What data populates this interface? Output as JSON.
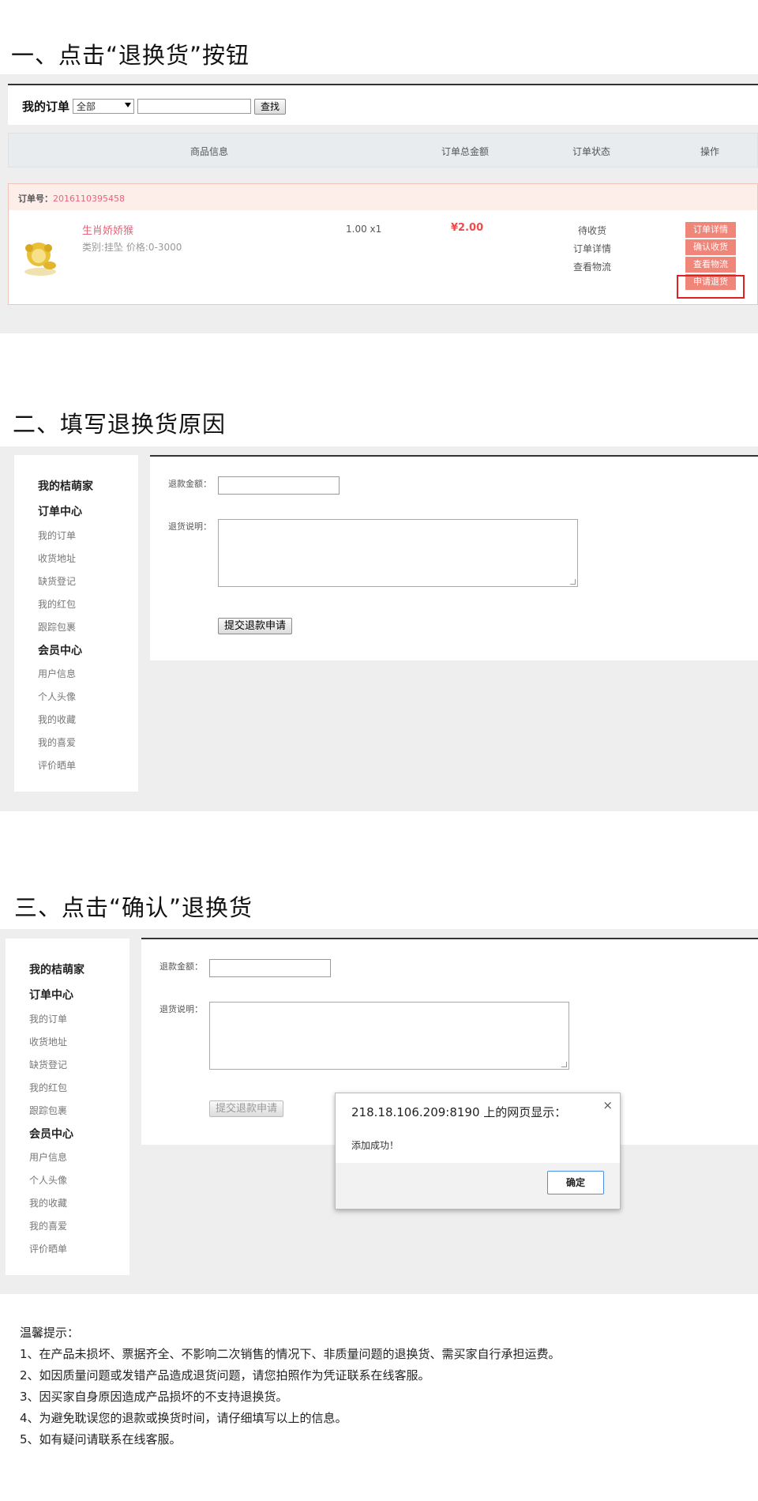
{
  "section1": {
    "title": "一、点击“退换货”按钮",
    "search": {
      "label": "我的订单",
      "select_value": "全部",
      "button": "查找"
    },
    "table_headers": [
      "商品信息",
      "订单总金额",
      "订单状态",
      "操作"
    ],
    "order": {
      "number_label": "订单号：",
      "number": "2016110395458",
      "product_name": "生肖娇娇猴",
      "product_meta": "类别:挂坠 价格:0-3000",
      "qty": "1.00 x1",
      "price": "¥2.00",
      "status_links": [
        "待收货",
        "订单详情",
        "查看物流"
      ],
      "actions": [
        "订单详情",
        "确认收货",
        "查看物流",
        "申请退货"
      ]
    }
  },
  "section2": {
    "title": "二、填写退换货原因",
    "sidebar": [
      {
        "text": "我的桔萌家",
        "type": "h"
      },
      {
        "text": "订单中心",
        "type": "h"
      },
      {
        "text": "我的订单",
        "type": "i"
      },
      {
        "text": "收货地址",
        "type": "i"
      },
      {
        "text": "缺货登记",
        "type": "i"
      },
      {
        "text": "我的红包",
        "type": "i"
      },
      {
        "text": "跟踪包裹",
        "type": "i"
      },
      {
        "text": "会员中心",
        "type": "h"
      },
      {
        "text": "用户信息",
        "type": "i"
      },
      {
        "text": "个人头像",
        "type": "i"
      },
      {
        "text": "我的收藏",
        "type": "i"
      },
      {
        "text": "我的喜爱",
        "type": "i"
      },
      {
        "text": "评价晒单",
        "type": "i"
      }
    ],
    "refund_amount_label": "退款金额：",
    "refund_note_label": "退货说明：",
    "submit": "提交退款申请"
  },
  "section3": {
    "title": "三、点击“确认”退换货",
    "dialog": {
      "title": "218.18.106.209:8190 上的网页显示：",
      "message": "添加成功！",
      "ok": "确定",
      "close": "×"
    }
  },
  "tips": {
    "title": "温馨提示：",
    "items": [
      "1、在产品未损坏、票据齐全、不影响二次销售的情况下、非质量问题的退换货、需买家自行承担运费。",
      "2、如因质量问题或发错产品造成退货问题，请您拍照作为凭证联系在线客服。",
      "3、因买家自身原因造成产品损坏的不支持退换货。",
      "4、为避免耽误您的退款或换货时间，请仔细填写以上的信息。",
      "5、如有疑问请联系在线客服。"
    ]
  },
  "colors": {
    "accent_red": "#f0857a",
    "pink_text": "#e8647a",
    "highlight_border": "#e02020"
  }
}
